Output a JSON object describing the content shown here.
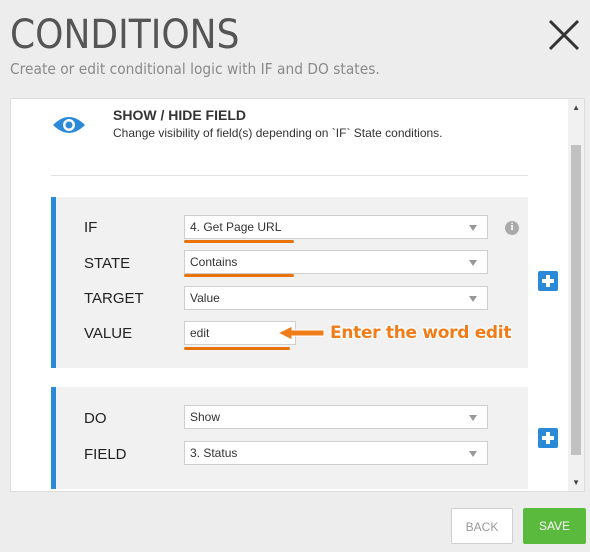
{
  "dialog": {
    "title": "CONDITIONS",
    "subtitle": "Create or edit conditional logic with IF and DO states."
  },
  "header": {
    "title": "SHOW / HIDE FIELD",
    "description": "Change visibility of field(s) depending on `IF` State conditions."
  },
  "if_block": {
    "rows": [
      {
        "label": "IF",
        "value": "4. Get Page URL"
      },
      {
        "label": "STATE",
        "value": "Contains"
      },
      {
        "label": "TARGET",
        "value": "Value"
      },
      {
        "label": "VALUE",
        "value": "edit"
      }
    ]
  },
  "do_block": {
    "rows": [
      {
        "label": "DO",
        "value": "Show"
      },
      {
        "label": "FIELD",
        "value": "3. Status"
      }
    ]
  },
  "annotation": "Enter the word edit",
  "footer": {
    "back_label": "BACK",
    "save_label": "SAVE"
  },
  "colors": {
    "accent_blue": "#2b8ad7",
    "highlight_orange": "#e8730b",
    "save_green": "#5aba3e"
  }
}
